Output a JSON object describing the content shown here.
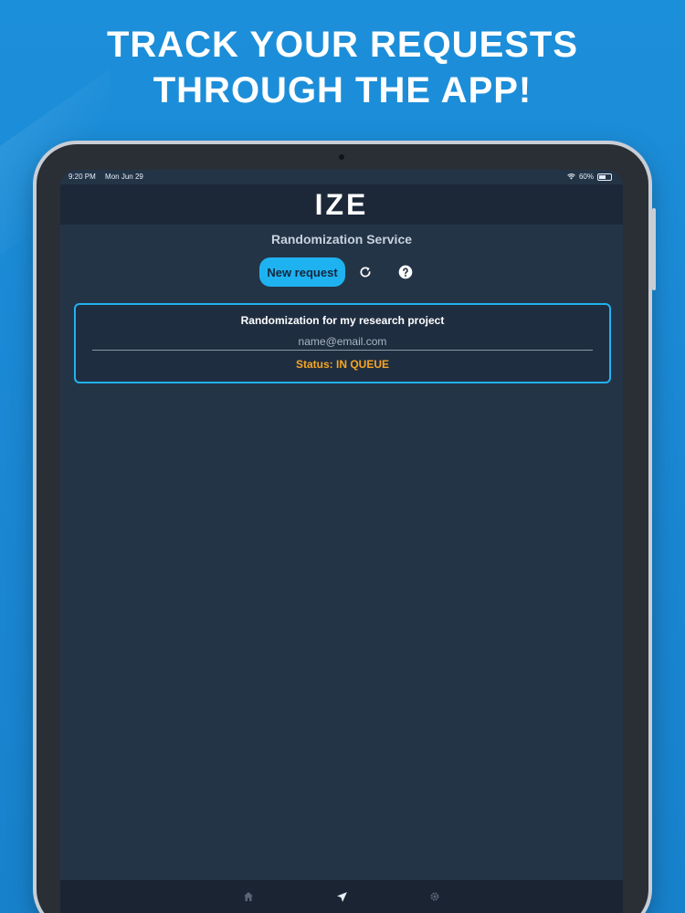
{
  "headline": {
    "line1": "TRACK YOUR REQUESTS",
    "line2": "THROUGH THE APP!"
  },
  "status_bar": {
    "time": "9:20 PM",
    "date": "Mon Jun 29",
    "battery": "60%"
  },
  "app": {
    "logo": "IZE",
    "service_title": "Randomization Service",
    "new_request_label": "New request",
    "refresh_icon": "refresh-icon",
    "help_icon": "question-circle-icon"
  },
  "request_card": {
    "title": "Randomization for my research project",
    "email": "name@email.com",
    "status": "Status: IN QUEUE"
  },
  "tab_bar": {
    "icons": [
      "home-icon",
      "paper-plane-icon",
      "gear-icon"
    ]
  },
  "colors": {
    "background": "#1c8fda",
    "app_bg": "#243447",
    "accent": "#1eb3f0",
    "status": "#f5a623"
  }
}
